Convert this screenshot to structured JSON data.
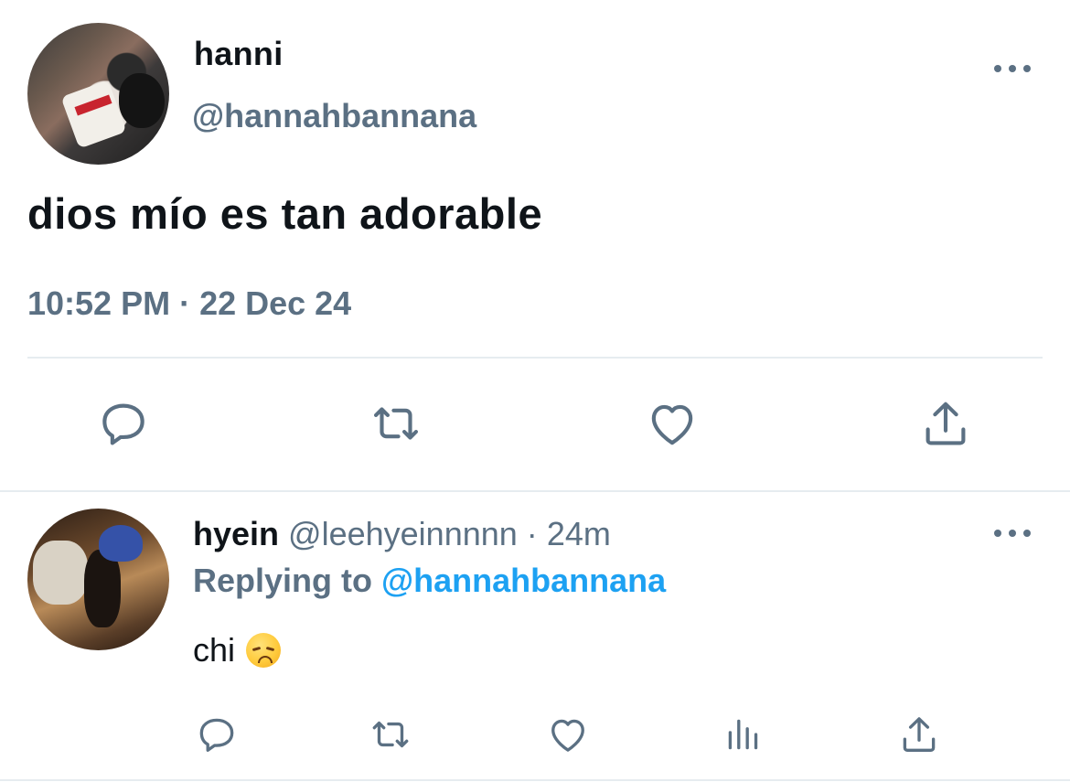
{
  "main_tweet": {
    "author_name": "hanni",
    "author_handle": "@hannahbannana",
    "text": "dios mío es tan adorable",
    "meta": "10:52 PM · 22 Dec 24",
    "more_icon": "more-horizontal-icon",
    "actions": [
      "reply-icon",
      "retweet-icon",
      "like-icon",
      "share-icon"
    ]
  },
  "reply": {
    "author_name": "hyein",
    "author_handle": "@leehyeinnnnn",
    "separator": "·",
    "time": "24m",
    "replying_label": "Replying to",
    "replying_handle": "@hannahbannana",
    "text": "chi",
    "emoji": "disappointed-face",
    "actions": [
      "reply-icon",
      "retweet-icon",
      "like-icon",
      "stats-icon",
      "share-icon"
    ]
  },
  "colors": {
    "text_primary": "#0f1419",
    "text_secondary": "#5b7083",
    "link": "#1da1f2",
    "divider": "#e6ecf0"
  }
}
